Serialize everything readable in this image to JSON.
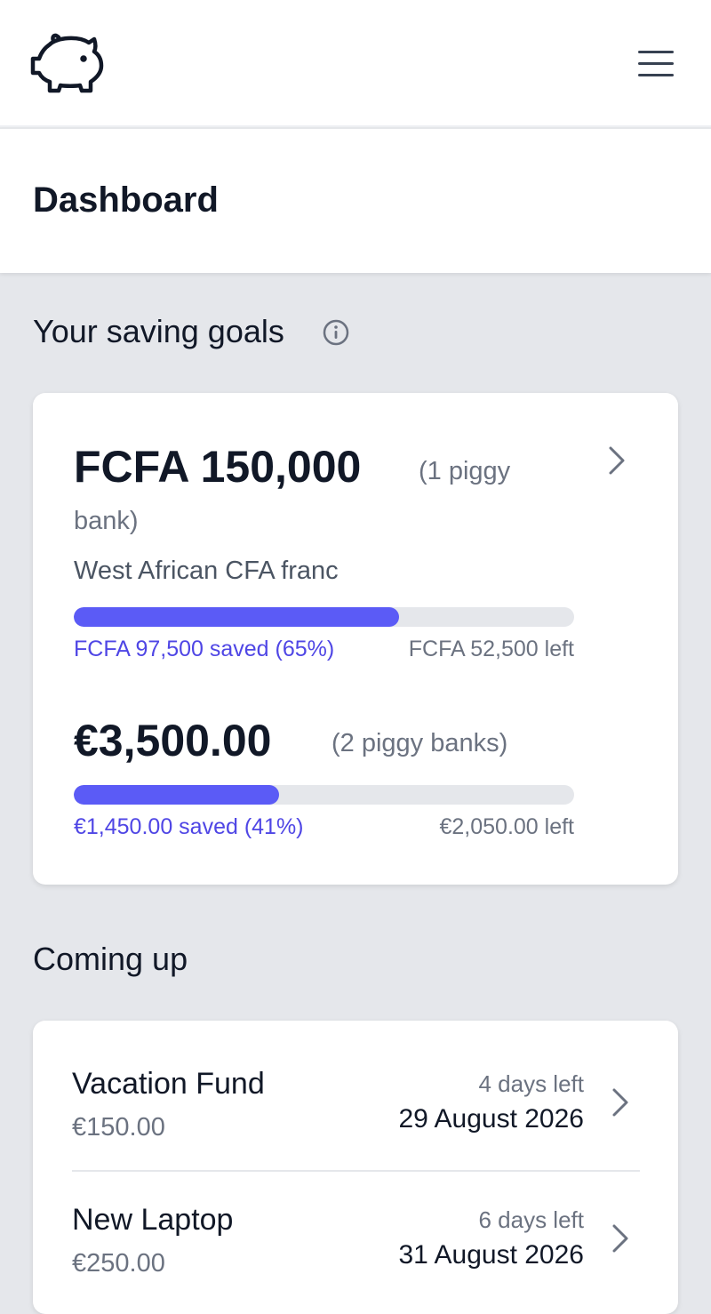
{
  "header": {
    "logo_icon": "piggy-bank-icon",
    "menu_icon": "hamburger-menu-icon"
  },
  "page_title": "Dashboard",
  "saving_goals": {
    "title": "Your saving goals",
    "info_icon": "info-icon",
    "goals": [
      {
        "amount": "FCFA 150,000",
        "count_line1": "(1 piggy",
        "count_line2": "bank)",
        "currency_name": "West African CFA franc",
        "progress": 0.65,
        "saved_label": "FCFA 97,500 saved (65%)",
        "left_label": "FCFA 52,500 left"
      },
      {
        "amount": "€3,500.00",
        "count": "(2 piggy banks)",
        "progress": 0.41,
        "saved_label": "€1,450.00 saved (41%)",
        "left_label": "€2,050.00 left"
      }
    ]
  },
  "coming_up": {
    "title": "Coming up",
    "items": [
      {
        "name": "Vacation Fund",
        "amount": "€150.00",
        "days_left": "4 days left",
        "date": "29 August 2026"
      },
      {
        "name": "New Laptop",
        "amount": "€250.00",
        "days_left": "6 days left",
        "date": "31 August 2026"
      }
    ]
  },
  "colors": {
    "accent": "#5b5bf6",
    "accent_text": "#4f46e5",
    "background": "#e5e7eb"
  }
}
